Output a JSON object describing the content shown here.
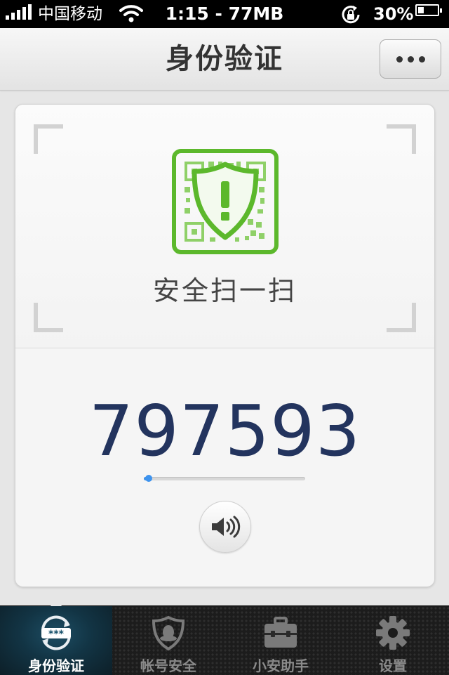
{
  "status_bar": {
    "carrier": "中国移动",
    "time": "1:15 - 77MB",
    "battery_text": "30%",
    "battery_level": 0.3
  },
  "nav": {
    "title": "身份验证"
  },
  "scan": {
    "label": "安全扫一扫"
  },
  "token": {
    "code": "797593",
    "progress": 0.03
  },
  "tabs": [
    {
      "label": "身份验证",
      "icon": "password-lock-icon",
      "active": true
    },
    {
      "label": "帐号安全",
      "icon": "shield-penguin-icon",
      "active": false
    },
    {
      "label": "小安助手",
      "icon": "toolbox-icon",
      "active": false
    },
    {
      "label": "设置",
      "icon": "gear-icon",
      "active": false
    }
  ],
  "colors": {
    "accent_green": "#5cb82c",
    "code_navy": "#23345e",
    "progress_blue": "#3a8ee6"
  }
}
